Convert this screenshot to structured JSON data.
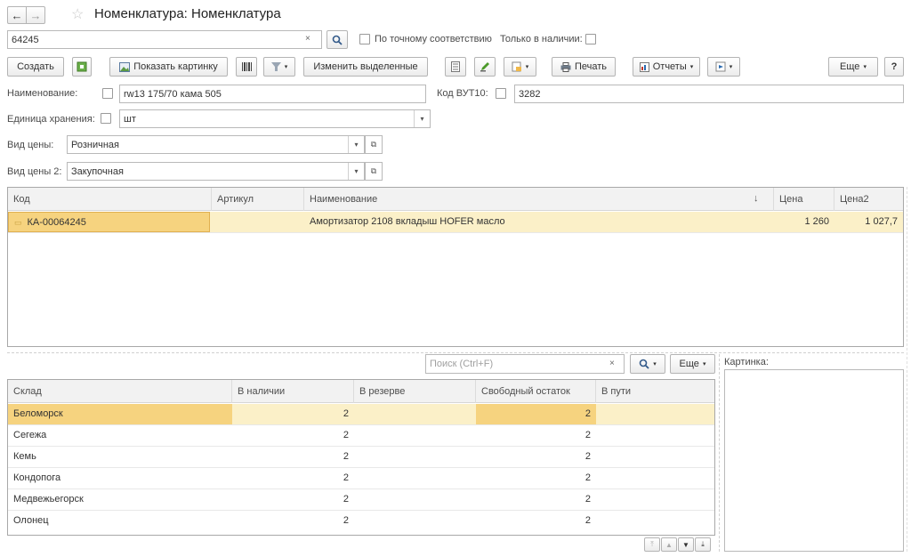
{
  "header": {
    "title": "Номенклатура: Номенклатура"
  },
  "search": {
    "value": "64245",
    "exact_match_label": "По точному соответствию",
    "in_stock_label": "Только в наличии:"
  },
  "toolbar": {
    "create": "Создать",
    "show_image": "Показать картинку",
    "edit_selected": "Изменить выделенные",
    "print": "Печать",
    "reports": "Отчеты",
    "more": "Еще",
    "help": "?"
  },
  "filters": {
    "name_label": "Наименование:",
    "name_value": "rw13 175/70 кама 505",
    "code_label": "Код ВУТ10:",
    "code_value": "3282",
    "unit_label": "Единица хранения:",
    "unit_value": "шт",
    "price_type_label": "Вид цены:",
    "price_type_value": "Розничная",
    "price_type2_label": "Вид цены 2:",
    "price_type2_value": "Закупочная"
  },
  "items_table": {
    "columns": [
      "Код",
      "Артикул",
      "Наименование",
      "Цена",
      "Цена2"
    ],
    "sort_indicator": "↓",
    "rows": [
      {
        "code": "КА-00064245",
        "article": "",
        "name": "Амортизатор 2108 вкладыш HOFER масло",
        "price": "1 260",
        "price2": "1 027,7"
      }
    ]
  },
  "stock_panel": {
    "search_placeholder": "Поиск (Ctrl+F)",
    "more": "Еще",
    "image_label": "Картинка:"
  },
  "stock_table": {
    "columns": [
      "Склад",
      "В наличии",
      "В резерве",
      "Свободный остаток",
      "В пути"
    ],
    "rows": [
      {
        "warehouse": "Беломорск",
        "in_stock": "2",
        "reserved": "",
        "free": "2",
        "transit": ""
      },
      {
        "warehouse": "Сегежа",
        "in_stock": "2",
        "reserved": "",
        "free": "2",
        "transit": ""
      },
      {
        "warehouse": "Кемь",
        "in_stock": "2",
        "reserved": "",
        "free": "2",
        "transit": ""
      },
      {
        "warehouse": "Кондопога",
        "in_stock": "2",
        "reserved": "",
        "free": "2",
        "transit": ""
      },
      {
        "warehouse": "Медвежьегорск",
        "in_stock": "2",
        "reserved": "",
        "free": "2",
        "transit": ""
      },
      {
        "warehouse": "Олонец",
        "in_stock": "2",
        "reserved": "",
        "free": "2",
        "transit": ""
      }
    ]
  },
  "colors": {
    "selected_row": "#fbf0c8",
    "selected_cell": "#f6d37f",
    "accent_green": "#4c9a2a"
  }
}
